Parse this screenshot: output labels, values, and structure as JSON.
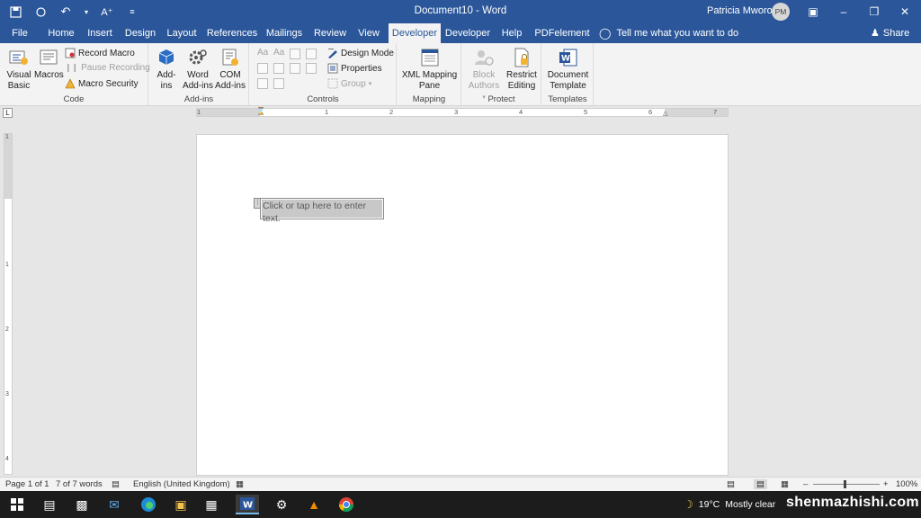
{
  "titlebar": {
    "document_title": "Document10  -  Word",
    "user_name": "Patricia Mworozi",
    "user_initials": "PM"
  },
  "tabs": [
    {
      "label": "File"
    },
    {
      "label": "Home"
    },
    {
      "label": "Insert"
    },
    {
      "label": "Design"
    },
    {
      "label": "Layout"
    },
    {
      "label": "References"
    },
    {
      "label": "Mailings"
    },
    {
      "label": "Review"
    },
    {
      "label": "View"
    },
    {
      "label": "Developer",
      "active": true
    },
    {
      "label": "Developer"
    },
    {
      "label": "Help"
    },
    {
      "label": "PDFelement"
    }
  ],
  "tell_me": "Tell me what you want to do",
  "share": "Share",
  "ribbon": {
    "code": {
      "label": "Code",
      "visual_basic": [
        "Visual",
        "Basic"
      ],
      "macros": "Macros",
      "record_macro": "Record Macro",
      "pause_recording": "Pause Recording",
      "macro_security": "Macro Security"
    },
    "addins": {
      "label": "Add-ins",
      "addins_btn": [
        "Add-",
        "ins"
      ],
      "word_addins": [
        "Word",
        "Add-ins"
      ],
      "com_addins": [
        "COM",
        "Add-ins"
      ]
    },
    "controls": {
      "label": "Controls",
      "design_mode": "Design Mode",
      "properties": "Properties",
      "group": "Group"
    },
    "mapping": {
      "label": "Mapping",
      "xml_pane": [
        "XML Mapping",
        "Pane"
      ]
    },
    "protect": {
      "label": "Protect",
      "block_authors": [
        "Block",
        "Authors"
      ],
      "restrict_editing": [
        "Restrict",
        "Editing"
      ]
    },
    "templates": {
      "label": "Templates",
      "document_template": [
        "Document",
        "Template"
      ]
    }
  },
  "ruler": {
    "h_numbers": [
      "1",
      "1",
      "2",
      "3",
      "4",
      "5",
      "6",
      "7"
    ],
    "v_numbers": [
      "1",
      "1",
      "2",
      "3",
      "4"
    ]
  },
  "document": {
    "placeholder": "Click or tap here to enter text."
  },
  "statusbar": {
    "page": "Page 1 of 1",
    "words": "7 of 7 words",
    "language": "English (United Kingdom)",
    "zoom": "100%"
  },
  "taskbar": {
    "temperature": "19°C",
    "weather": "Mostly clear",
    "watermark": "shenmazhishi.com"
  },
  "colors": {
    "word_blue": "#2b579a",
    "ribbon_bg": "#f3f3f3",
    "canvas_bg": "#e6e6e6",
    "taskbar_bg": "#1c1c1c"
  }
}
